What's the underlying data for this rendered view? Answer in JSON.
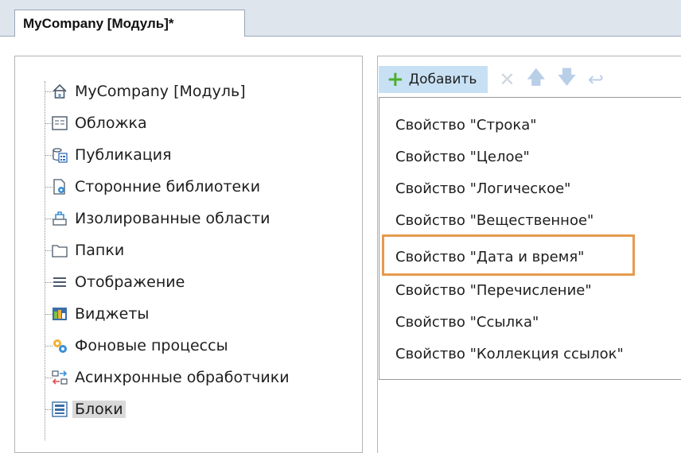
{
  "tab": {
    "title": "MyCompany [Модуль]*"
  },
  "tree": {
    "items": [
      {
        "label": "MyCompany [Модуль]",
        "icon": "home-icon"
      },
      {
        "label": "Обложка",
        "icon": "cover-icon"
      },
      {
        "label": "Публикация",
        "icon": "publication-icon"
      },
      {
        "label": "Сторонние библиотеки",
        "icon": "library-gear-icon"
      },
      {
        "label": "Изолированные области",
        "icon": "isolated-area-icon"
      },
      {
        "label": "Папки",
        "icon": "folder-icon"
      },
      {
        "label": "Отображение",
        "icon": "list-icon"
      },
      {
        "label": "Виджеты",
        "icon": "widget-icon"
      },
      {
        "label": "Фоновые процессы",
        "icon": "gears-icon"
      },
      {
        "label": "Асинхронные обработчики",
        "icon": "async-arrows-icon"
      },
      {
        "label": "Блоки",
        "icon": "blocks-icon"
      }
    ],
    "selected_index": 10
  },
  "toolbar": {
    "add_label": "Добавить",
    "icons": [
      "plus-icon",
      "delete-icon",
      "arrow-up-icon",
      "arrow-down-icon",
      "undo-icon"
    ]
  },
  "menu": {
    "items": [
      "Свойство \"Строка\"",
      "Свойство \"Целое\"",
      "Свойство \"Логическое\"",
      "Свойство \"Вещественное\"",
      "Свойство \"Дата и время\"",
      "Свойство \"Перечисление\"",
      "Свойство \"Ссылка\"",
      "Свойство \"Коллекция ссылок\""
    ],
    "highlighted_index": 4
  },
  "colors": {
    "highlight": "#e69a4d",
    "add_button_bg": "#c7e0f4",
    "plus": "#4caf2f",
    "selected_bg": "#d9d9d9"
  }
}
